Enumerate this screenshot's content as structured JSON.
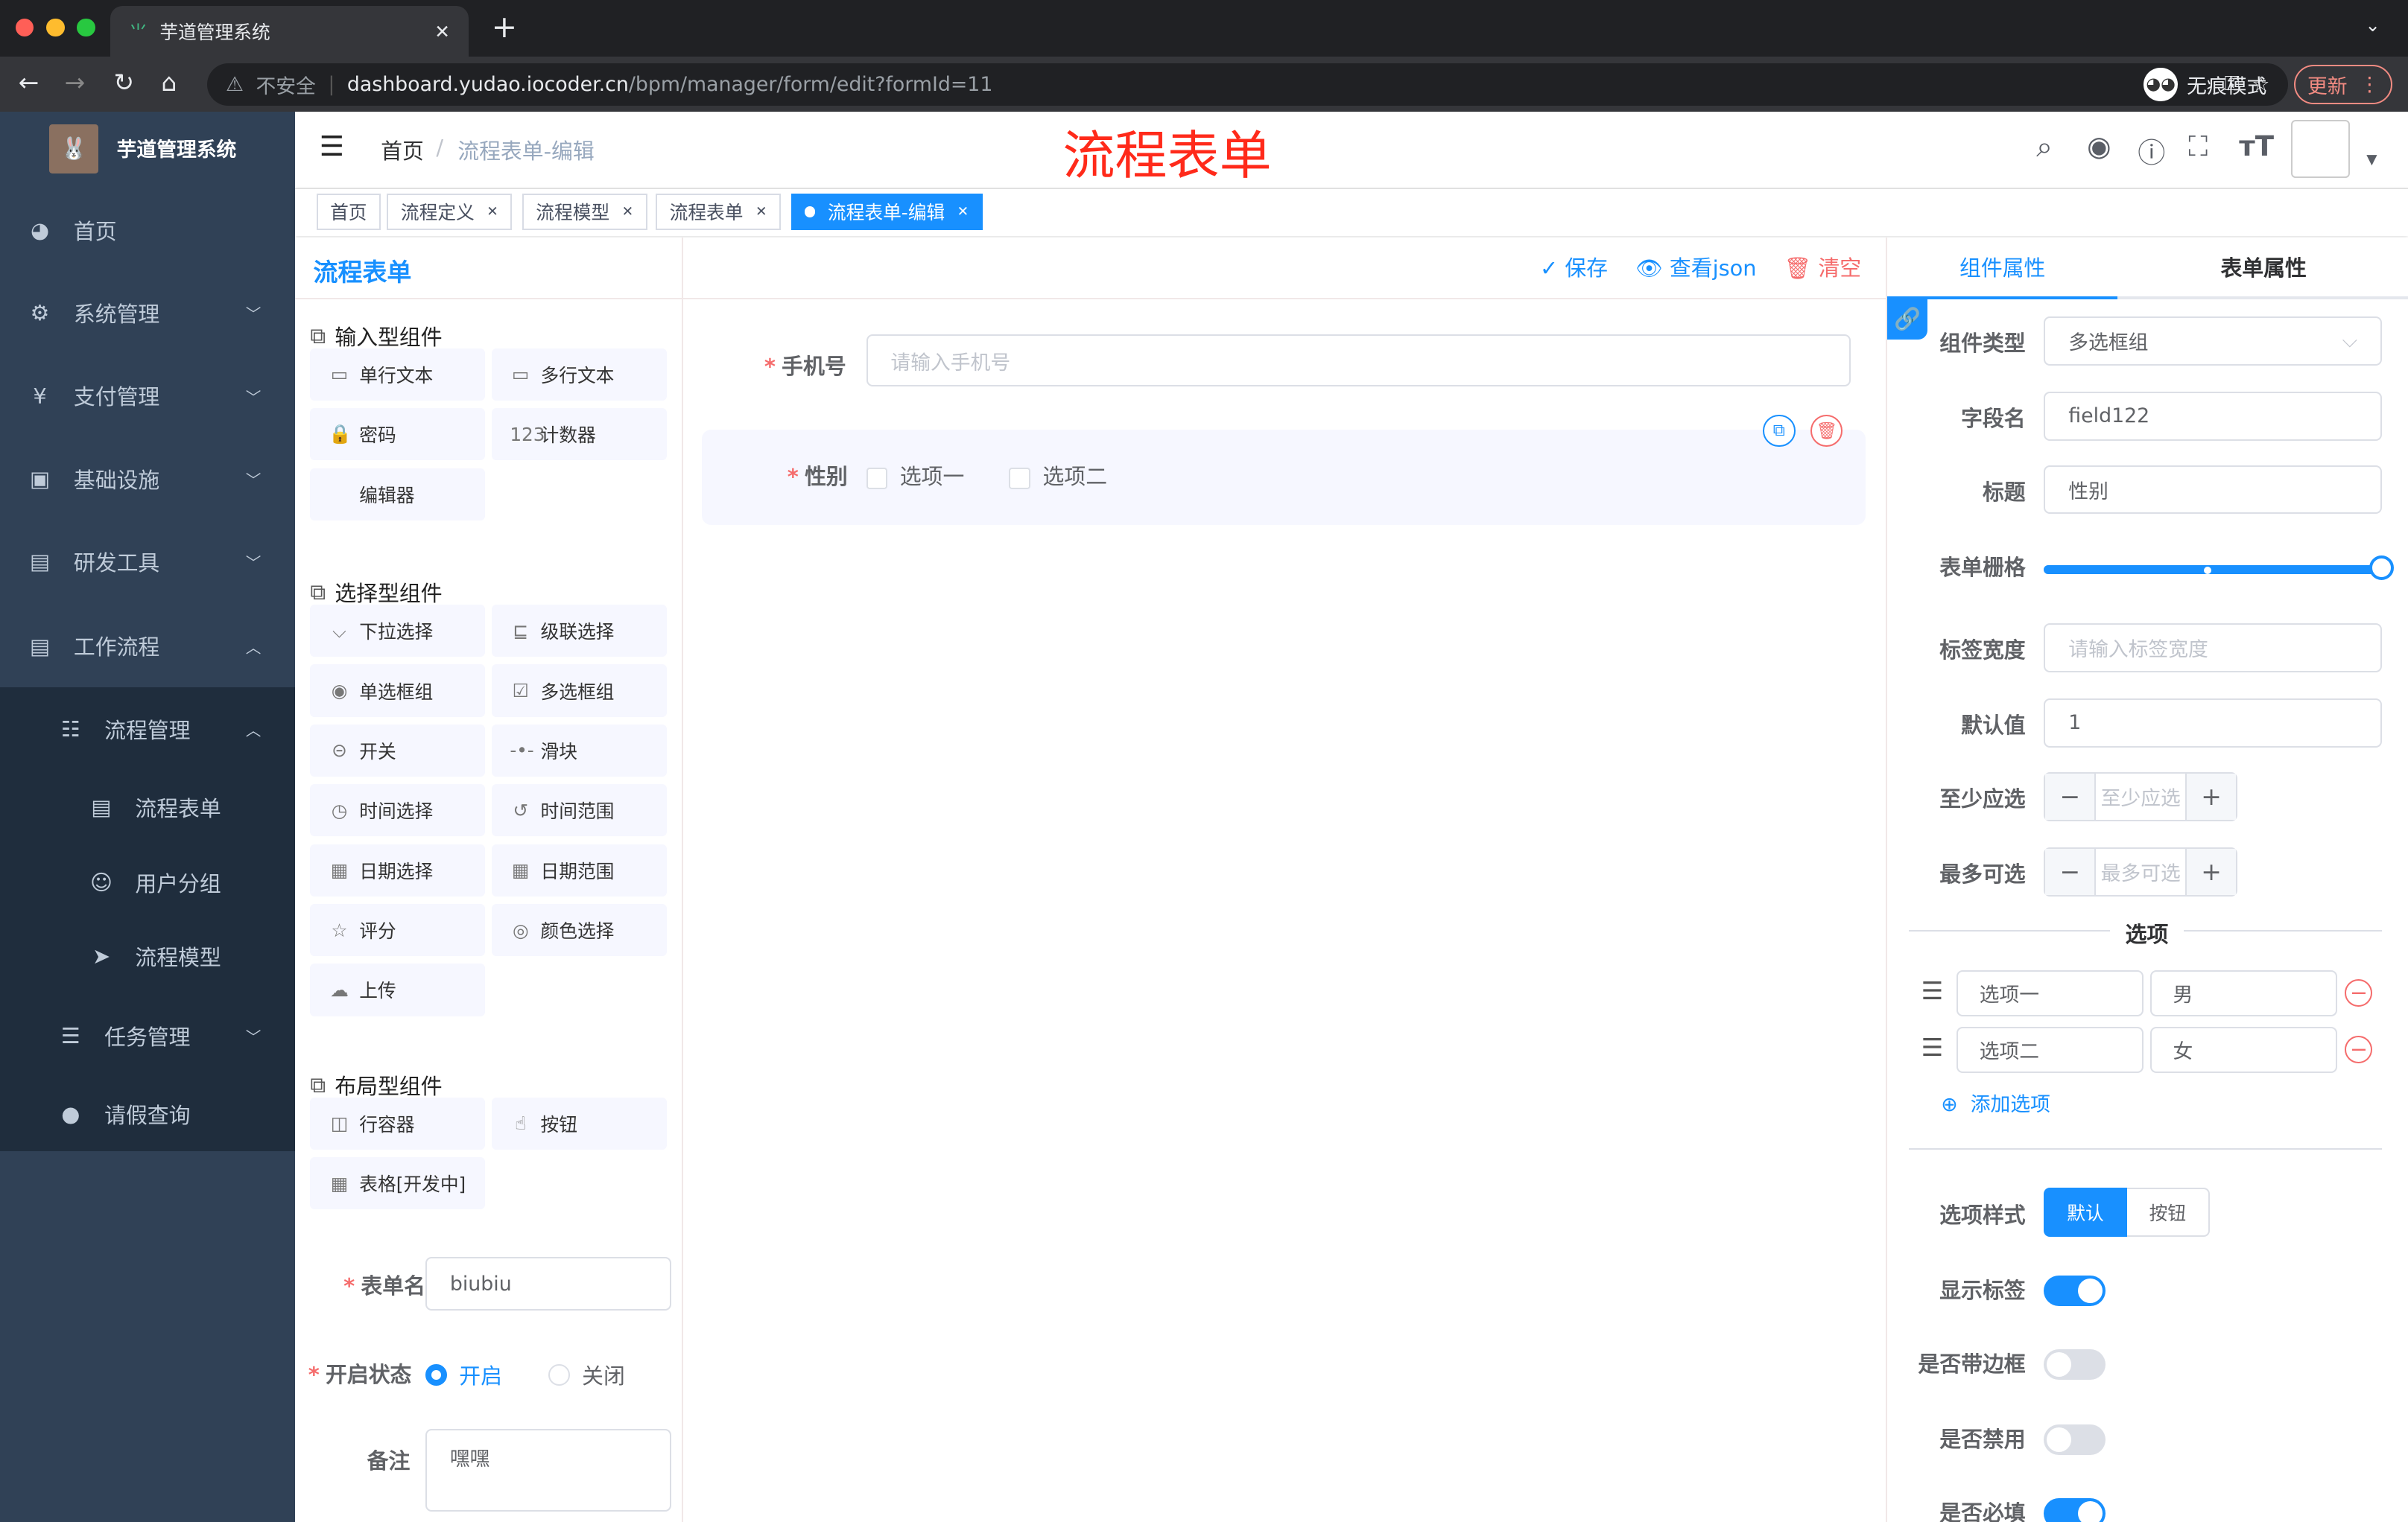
{
  "browser": {
    "tab_title": "芋道管理系统",
    "security": "不安全",
    "url_host": "dashboard.yudao.iocoder.cn",
    "url_path": "/bpm/manager/form/edit?formId=11",
    "incognito": "无痕模式",
    "update": "更新"
  },
  "sidebar": {
    "title": "芋道管理系统",
    "items": [
      {
        "label": "首页",
        "icon": "dashboard-icon"
      },
      {
        "label": "系统管理",
        "icon": "gear-icon"
      },
      {
        "label": "支付管理",
        "icon": "yen-icon"
      },
      {
        "label": "基础设施",
        "icon": "monitor-icon"
      },
      {
        "label": "研发工具",
        "icon": "toolbox-icon"
      },
      {
        "label": "工作流程",
        "icon": "toolbox-icon"
      },
      {
        "label": "流程管理",
        "icon": "tree-list-icon"
      },
      {
        "label": "流程表单",
        "icon": "form-icon"
      },
      {
        "label": "用户分组",
        "icon": "user-group-icon"
      },
      {
        "label": "流程模型",
        "icon": "send-icon"
      },
      {
        "label": "任务管理",
        "icon": "task-icon"
      },
      {
        "label": "请假查询",
        "icon": "user-icon"
      }
    ]
  },
  "navbar": {
    "breadcrumb_home": "首页",
    "breadcrumb_current": "流程表单-编辑",
    "page_heading": "流程表单"
  },
  "tags": [
    "首页",
    "流程定义",
    "流程模型",
    "流程表单",
    "流程表单-编辑"
  ],
  "editor": {
    "title": "流程表单",
    "save": "保存",
    "view_json": "查看json",
    "clear": "清空"
  },
  "components": {
    "input_title": "输入型组件",
    "input": [
      {
        "label": "单行文本",
        "icon": "▭"
      },
      {
        "label": "多行文本",
        "icon": "▭"
      },
      {
        "label": "密码",
        "icon": "🔒"
      },
      {
        "label": "计数器",
        "icon": "123"
      },
      {
        "label": "编辑器",
        "icon": ""
      }
    ],
    "select_title": "选择型组件",
    "select": [
      {
        "label": "下拉选择",
        "icon": "⌵"
      },
      {
        "label": "级联选择",
        "icon": "⊑"
      },
      {
        "label": "单选框组",
        "icon": "◉"
      },
      {
        "label": "多选框组",
        "icon": "☑"
      },
      {
        "label": "开关",
        "icon": "⊝"
      },
      {
        "label": "滑块",
        "icon": "-•-"
      },
      {
        "label": "时间选择",
        "icon": "◷"
      },
      {
        "label": "时间范围",
        "icon": "↺"
      },
      {
        "label": "日期选择",
        "icon": "▦"
      },
      {
        "label": "日期范围",
        "icon": "▦"
      },
      {
        "label": "评分",
        "icon": "☆"
      },
      {
        "label": "颜色选择",
        "icon": "◎"
      },
      {
        "label": "上传",
        "icon": "☁"
      }
    ],
    "layout_title": "布局型组件",
    "layout": [
      {
        "label": "行容器",
        "icon": "◫"
      },
      {
        "label": "按钮",
        "icon": "☝"
      },
      {
        "label": "表格[开发中]",
        "icon": "▦"
      }
    ]
  },
  "form_meta": {
    "name_label": "表单名",
    "name_value": "biubiu",
    "status_label": "开启状态",
    "status_on": "开启",
    "status_off": "关闭",
    "status_selected": "开启",
    "remark_label": "备注",
    "remark_value": "嘿嘿"
  },
  "canvas": {
    "phone_label": "手机号",
    "phone_placeholder": "请输入手机号",
    "gender_label": "性别",
    "options": [
      "选项一",
      "选项二"
    ]
  },
  "props": {
    "tab_component": "组件属性",
    "tab_form": "表单属性",
    "type_label": "组件类型",
    "type_value": "多选框组",
    "field_label": "字段名",
    "field_value": "field122",
    "title_label": "标题",
    "title_value": "性别",
    "grid_label": "表单栅格",
    "grid_value": 24,
    "grid_max": 24,
    "labelwidth_label": "标签宽度",
    "labelwidth_placeholder": "请输入标签宽度",
    "default_label": "默认值",
    "default_value": "1",
    "min_label": "至少应选",
    "min_placeholder": "至少应选",
    "max_label": "最多可选",
    "max_placeholder": "最多可选",
    "options_divider": "选项",
    "options": [
      {
        "label": "选项一",
        "value": "男"
      },
      {
        "label": "选项二",
        "value": "女"
      }
    ],
    "add_option": "添加选项",
    "style_label": "选项样式",
    "style_default": "默认",
    "style_button": "按钮",
    "style_selected": "默认",
    "show_label": "显示标签",
    "show_label_on": true,
    "border_label": "是否带边框",
    "border_on": false,
    "disabled_label": "是否禁用",
    "disabled_on": false,
    "required_label": "是否必填",
    "required_on": true
  },
  "colors": {
    "primary": "#1890ff",
    "sidebar": "#304156",
    "danger": "#f56c6c",
    "heading_red": "#ff2a1a"
  }
}
